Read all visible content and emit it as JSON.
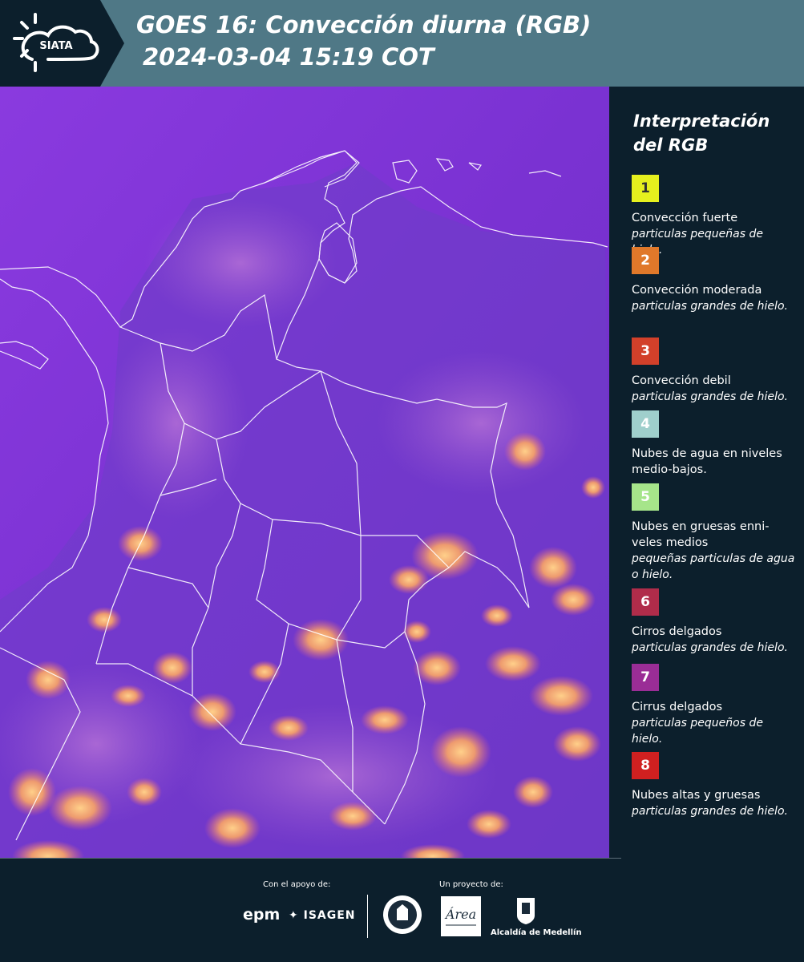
{
  "header": {
    "logo_text": "SIATA",
    "title_line1": "GOES 16: Convección diurna (RGB)",
    "title_line2": "2024-03-04 15:19 COT"
  },
  "legend": {
    "title_line1": "Interpretación",
    "title_line2": "del RGB",
    "items": [
      {
        "number": "1",
        "color": "#e6f01e",
        "label": "Convección fuerte",
        "sub": "particulas pequeñas de hielo."
      },
      {
        "number": "2",
        "color": "#e0782a",
        "label": "Convección moderada",
        "sub": "particulas grandes de hielo."
      },
      {
        "number": "3",
        "color": "#d2402a",
        "label": "Convección debil",
        "sub": "particulas grandes de hielo."
      },
      {
        "number": "4",
        "color": "#9fcfcc",
        "label": "Nubes de agua en niveles medio-bajos.",
        "sub": ""
      },
      {
        "number": "5",
        "color": "#a6e58a",
        "label": "Nubes en gruesas enni-veles medios",
        "sub": "pequeñas particulas de agua o hielo."
      },
      {
        "number": "6",
        "color": "#b02c4a",
        "label": "Cirros delgados",
        "sub": "particulas grandes de hielo."
      },
      {
        "number": "7",
        "color": "#9a2d96",
        "label": "Cirrus delgados",
        "sub": "particulas pequeños de hielo."
      },
      {
        "number": "8",
        "color": "#d02020",
        "label": "Nubes altas y gruesas",
        "sub": "particulas grandes de hielo."
      }
    ]
  },
  "footer": {
    "support_label": "Con el apoyo de:",
    "project_label": "Un proyecto de:",
    "epm": "epm",
    "isagen": "ISAGEN",
    "alcaldia": "Alcaldía de Medellín"
  },
  "colors": {
    "header_bg": "#4f7886",
    "panel_bg": "#0c1f2c",
    "map_base": "#7c2fd0",
    "convection": "#f4a36a"
  }
}
